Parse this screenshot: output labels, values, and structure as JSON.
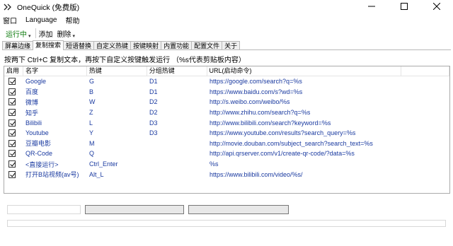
{
  "window": {
    "title": "OneQuick (免费版)"
  },
  "menu": {
    "items": [
      "窗口",
      "Language",
      "帮助"
    ]
  },
  "toolbar": {
    "running": "运行中",
    "add": "添加",
    "delete": "删除"
  },
  "tabs": [
    "屏幕边缘",
    "复制搜索",
    "短语替换",
    "自定义热键",
    "按键映射",
    "内置功能",
    "配置文件",
    "关于"
  ],
  "active_tab": "复制搜索",
  "hint": "按两下 Ctrl+C 复制文本，再按下自定义按键触发运行 （%s代表剪贴板内容）",
  "table": {
    "headers": [
      "启用",
      "名字",
      "热键",
      "分组热键",
      "URL(启动命令)",
      ""
    ],
    "rows": [
      {
        "enabled": true,
        "name": "Google",
        "hotkey": "G",
        "group": "D1",
        "url": "https://google.com/search?q=%s"
      },
      {
        "enabled": true,
        "name": "百度",
        "hotkey": "B",
        "group": "D1",
        "url": "https://www.baidu.com/s?wd=%s"
      },
      {
        "enabled": true,
        "name": "微博",
        "hotkey": "W",
        "group": "D2",
        "url": "http://s.weibo.com/weibo/%s"
      },
      {
        "enabled": true,
        "name": "知乎",
        "hotkey": "Z",
        "group": "D2",
        "url": "http://www.zhihu.com/search?q=%s"
      },
      {
        "enabled": true,
        "name": "Bilibili",
        "hotkey": "L",
        "group": "D3",
        "url": "http://www.bilibili.com/search?keyword=%s"
      },
      {
        "enabled": true,
        "name": "Youtube",
        "hotkey": "Y",
        "group": "D3",
        "url": "https://www.youtube.com/results?search_query=%s"
      },
      {
        "enabled": true,
        "name": "豆瓣电影",
        "hotkey": "M",
        "group": "",
        "url": "http://movie.douban.com/subject_search?search_text=%s"
      },
      {
        "enabled": true,
        "name": "QR-Code",
        "hotkey": "Q",
        "group": "",
        "url": "http://api.qrserver.com/v1/create-qr-code/?data=%s"
      },
      {
        "enabled": true,
        "name": "<直接运行>",
        "hotkey": "Ctrl_Enter",
        "group": "",
        "url": "%s"
      },
      {
        "enabled": true,
        "name": "打开B站视频(av号)",
        "hotkey": "Alt_L",
        "group": "",
        "url": "https://www.bilibili.com/video/%s/"
      }
    ]
  },
  "icons": {
    "app": "double-chevron-icon",
    "minimize": "minimize-icon",
    "maximize": "maximize-icon",
    "close": "close-icon"
  },
  "colors": {
    "running": "#0a7a0a",
    "row_text": "#1a3aa0"
  }
}
